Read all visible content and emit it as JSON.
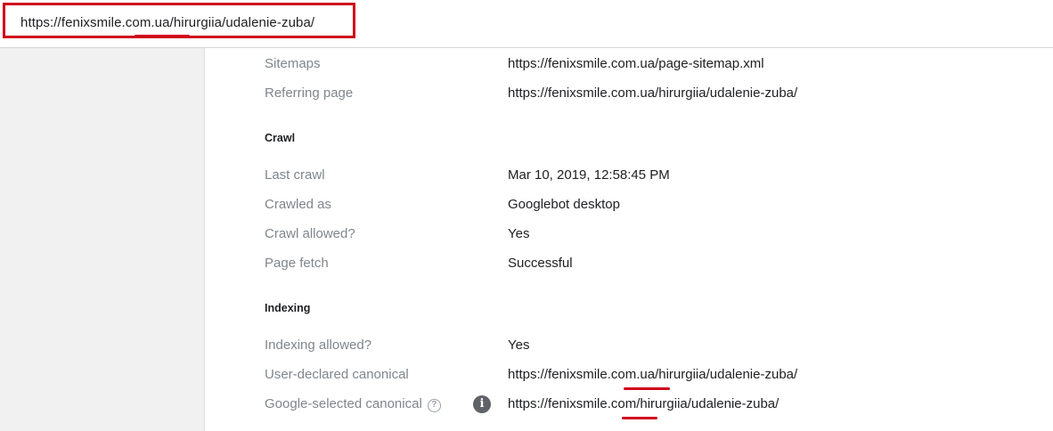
{
  "address_bar": {
    "url": "https://fenixsmile.com.ua/hirurgiia/udalenie-zuba/"
  },
  "discovery": {
    "rows": [
      {
        "label": "Sitemaps",
        "value": "https://fenixsmile.com.ua/page-sitemap.xml"
      },
      {
        "label": "Referring page",
        "value": "https://fenixsmile.com.ua/hirurgiia/udalenie-zuba/"
      }
    ]
  },
  "crawl": {
    "heading": "Crawl",
    "rows": [
      {
        "label": "Last crawl",
        "value": "Mar 10, 2019, 12:58:45 PM"
      },
      {
        "label": "Crawled as",
        "value": "Googlebot desktop"
      },
      {
        "label": "Crawl allowed?",
        "value": "Yes"
      },
      {
        "label": "Page fetch",
        "value": "Successful"
      }
    ]
  },
  "indexing": {
    "heading": "Indexing",
    "rows": [
      {
        "label": "Indexing allowed?",
        "value": "Yes"
      },
      {
        "label": "User-declared canonical",
        "value": "https://fenixsmile.com.ua/hirurgiia/udalenie-zuba/"
      },
      {
        "label": "Google-selected canonical",
        "value": "https://fenixsmile.com/hirurgiia/udalenie-zuba/",
        "help_icon": "?",
        "info_icon": "i"
      }
    ]
  },
  "annotation_color": "#d0021b"
}
